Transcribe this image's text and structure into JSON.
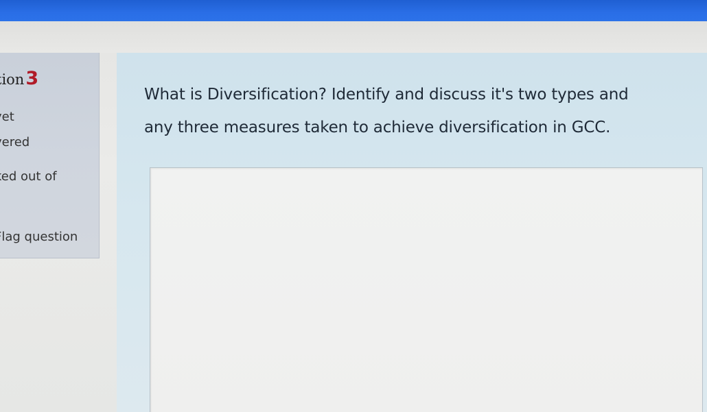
{
  "question_info": {
    "heading_label": "tion",
    "number": "3",
    "status_line1": "yet",
    "status_line2": "vered",
    "marks_line": "ked out of",
    "flag_label": "Flag question"
  },
  "question": {
    "line1": "What is Diversification? Identify and discuss it's two types and",
    "line2": "any three measures taken to achieve diversification in GCC."
  },
  "answer": {
    "value": ""
  },
  "colors": {
    "top_bar": "#2a6ee6",
    "question_number": "#b01b28",
    "info_panel": "#cfd5de",
    "content_panel": "#d6e7ef"
  }
}
